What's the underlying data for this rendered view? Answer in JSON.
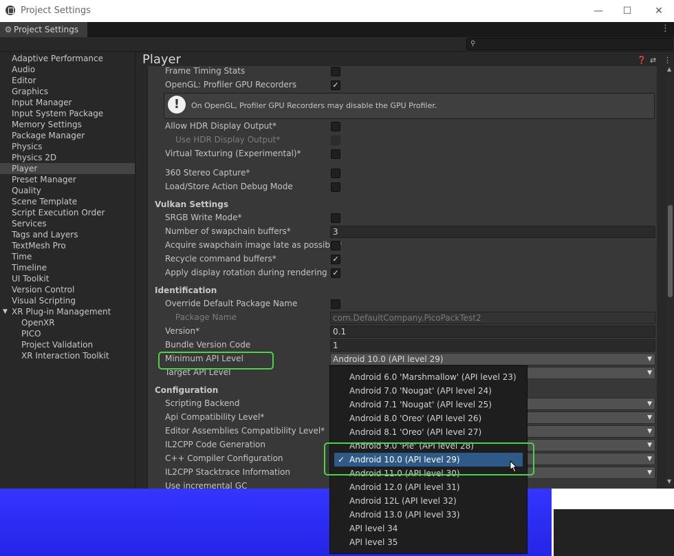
{
  "window": {
    "title": "Project Settings",
    "minimize": "—",
    "maximize": "☐",
    "close": "✕"
  },
  "tab": {
    "label": "Project Settings",
    "menu": "⋮"
  },
  "search": {
    "icon": "🔍",
    "placeholder": ""
  },
  "sidebar": {
    "items": [
      {
        "label": "Adaptive Performance"
      },
      {
        "label": "Audio"
      },
      {
        "label": "Editor"
      },
      {
        "label": "Graphics"
      },
      {
        "label": "Input Manager"
      },
      {
        "label": "Input System Package"
      },
      {
        "label": "Memory Settings"
      },
      {
        "label": "Package Manager"
      },
      {
        "label": "Physics"
      },
      {
        "label": "Physics 2D"
      },
      {
        "label": "Player",
        "selected": true
      },
      {
        "label": "Preset Manager"
      },
      {
        "label": "Quality"
      },
      {
        "label": "Scene Template"
      },
      {
        "label": "Script Execution Order"
      },
      {
        "label": "Services"
      },
      {
        "label": "Tags and Layers"
      },
      {
        "label": "TextMesh Pro"
      },
      {
        "label": "Time"
      },
      {
        "label": "Timeline"
      },
      {
        "label": "UI Toolkit"
      },
      {
        "label": "Version Control"
      },
      {
        "label": "Visual Scripting"
      },
      {
        "label": "XR Plug-in Management",
        "expanded": true
      },
      {
        "label": "OpenXR",
        "child": true
      },
      {
        "label": "PICO",
        "child": true
      },
      {
        "label": "Project Validation",
        "child": true
      },
      {
        "label": "XR Interaction Toolkit",
        "child": true
      }
    ]
  },
  "main": {
    "title": "Player",
    "header_icons": [
      "help-icon",
      "preset-icon",
      "menu-icon"
    ],
    "help_box": {
      "icon": "!",
      "text": "On OpenGL, Profiler GPU Recorders may disable the GPU Profiler."
    },
    "rows": {
      "frame_timing": {
        "label": "Frame Timing Stats",
        "checked": false
      },
      "opengl_profiler": {
        "label": "OpenGL: Profiler GPU Recorders",
        "checked": true
      },
      "allow_hdr": {
        "label": "Allow HDR Display Output*",
        "checked": false
      },
      "use_hdr": {
        "label": "Use HDR Display Output*",
        "checked": false,
        "disabled": true
      },
      "virtual_texturing": {
        "label": "Virtual Texturing (Experimental)*",
        "checked": false
      },
      "stereo_capture": {
        "label": "360 Stereo Capture*",
        "checked": false
      },
      "load_store": {
        "label": "Load/Store Action Debug Mode",
        "checked": false
      },
      "vulkan_header": {
        "label": "Vulkan Settings"
      },
      "srgb": {
        "label": "SRGB Write Mode*",
        "checked": false
      },
      "swapchain": {
        "label": "Number of swapchain buffers*",
        "value": "3"
      },
      "acquire": {
        "label": "Acquire swapchain image late as possible*",
        "checked": false
      },
      "recycle": {
        "label": "Recycle command buffers*",
        "checked": true
      },
      "display_rotation": {
        "label": "Apply display rotation during rendering",
        "checked": true
      },
      "ident_header": {
        "label": "Identification"
      },
      "override_pkg": {
        "label": "Override Default Package Name",
        "checked": false
      },
      "package_name": {
        "label": "Package Name",
        "value": "com.DefaultCompany.PicoPackTest2",
        "disabled": true
      },
      "version": {
        "label": "Version*",
        "value": "0.1"
      },
      "bundle_code": {
        "label": "Bundle Version Code",
        "value": "1"
      },
      "min_api": {
        "label": "Minimum API Level",
        "value": "Android 10.0 (API level 29)"
      },
      "target_api": {
        "label": "Target API Level",
        "value": ""
      },
      "config_header": {
        "label": "Configuration"
      },
      "scripting_backend": {
        "label": "Scripting Backend",
        "value": ""
      },
      "api_compat": {
        "label": "Api Compatibility Level*",
        "value": ""
      },
      "editor_assemblies": {
        "label": "Editor Assemblies Compatibility Level*",
        "value": ""
      },
      "il2cpp_gen": {
        "label": "IL2CPP Code Generation",
        "value": ""
      },
      "cpp_compiler": {
        "label": "C++ Compiler Configuration",
        "value": ""
      },
      "il2cpp_stack": {
        "label": "IL2CPP Stacktrace Information",
        "value": ""
      },
      "incremental_gc": {
        "label": "Use incremental GC"
      }
    }
  },
  "popup": {
    "options": [
      {
        "label": "Android 6.0 'Marshmallow' (API level 23)"
      },
      {
        "label": "Android 7.0 'Nougat' (API level 24)"
      },
      {
        "label": "Android 7.1 'Nougat' (API level 25)"
      },
      {
        "label": "Android 8.0 'Oreo' (API level 26)"
      },
      {
        "label": "Android 8.1 'Oreo' (API level 27)"
      },
      {
        "label": "Android 9.0 'Pie' (API level 28)"
      },
      {
        "label": "Android 10.0 (API level 29)",
        "selected": true
      },
      {
        "label": "Android 11.0 (API level 30)"
      },
      {
        "label": "Android 12.0 (API level 31)"
      },
      {
        "label": "Android 12L (API level 32)"
      },
      {
        "label": "Android 13.0 (API level 33)"
      },
      {
        "label": "API level 34"
      },
      {
        "label": "API level 35"
      }
    ],
    "check": "✓"
  },
  "colors": {
    "highlight": "#48d646",
    "selection": "#2d5a86",
    "desktop_blue": "#3435ff"
  }
}
